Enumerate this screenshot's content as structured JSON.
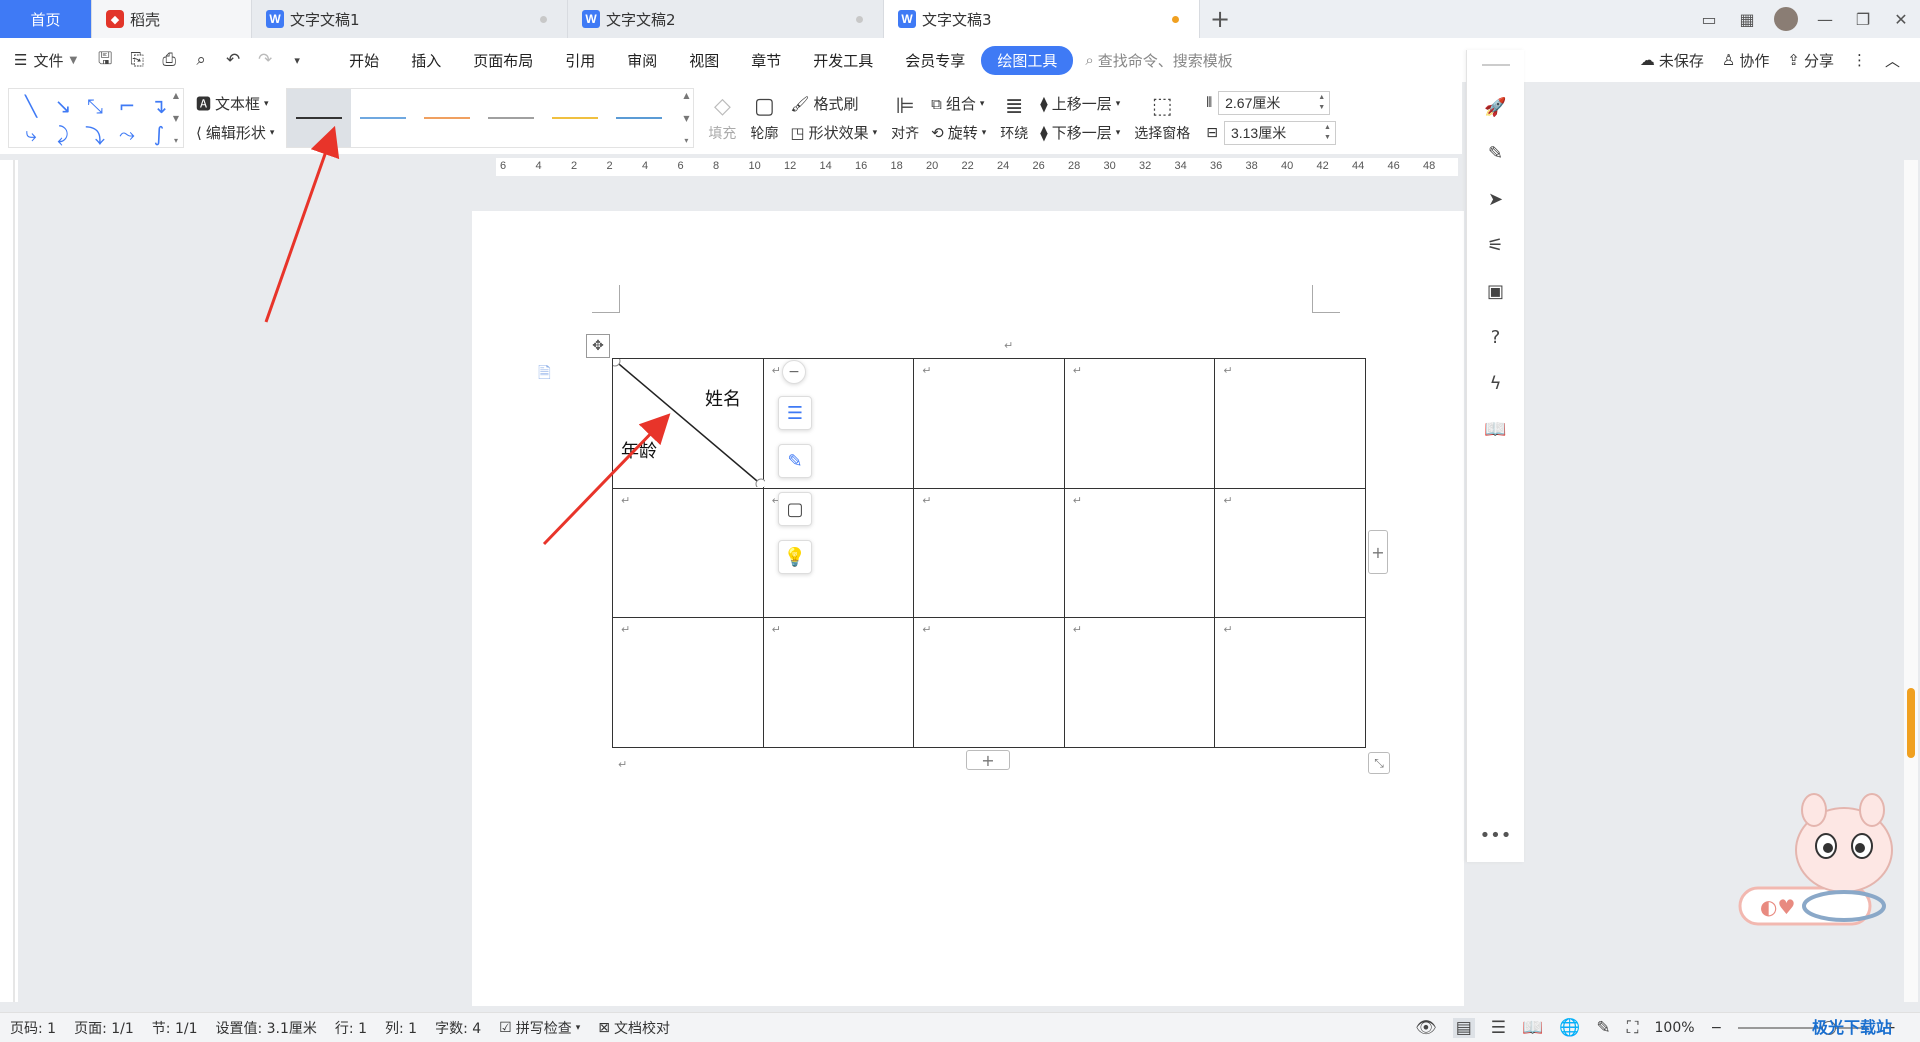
{
  "tabs": {
    "home": "首页",
    "daoke": "稻壳",
    "doc1": "文字文稿1",
    "doc2": "文字文稿2",
    "doc3": "文字文稿3",
    "doc_icon": "W",
    "add": "+"
  },
  "menu": {
    "file": "文件",
    "items": [
      "开始",
      "插入",
      "页面布局",
      "引用",
      "审阅",
      "视图",
      "章节",
      "开发工具",
      "会员专享"
    ],
    "active": "绘图工具",
    "search_placeholder": "查找命令、搜索模板",
    "unsaved": "未保存",
    "collab": "协作",
    "share": "分享"
  },
  "ribbon": {
    "textbox": "文本框",
    "edit_shape": "编辑形状",
    "fill": "填充",
    "outline": "轮廓",
    "format_painter": "格式刷",
    "shape_effect": "形状效果",
    "align": "对齐",
    "group": "组合",
    "rotate": "旋转",
    "wrap": "环绕",
    "bring_forward": "上移一层",
    "send_backward": "下移一层",
    "selection_pane": "选择窗格",
    "height": "2.67厘米",
    "width": "3.13厘米",
    "line_colors": [
      "#333333",
      "#6fa8e0",
      "#f0a060",
      "#a0a0a0",
      "#f0c040",
      "#5b9bd5"
    ]
  },
  "ruler_labels": [
    "6",
    "4",
    "2",
    "2",
    "4",
    "6",
    "8",
    "10",
    "12",
    "14",
    "16",
    "18",
    "20",
    "22",
    "24",
    "26",
    "28",
    "30",
    "32",
    "34",
    "36",
    "38",
    "40",
    "42",
    "44",
    "46",
    "48"
  ],
  "table": {
    "header_top": "姓名",
    "header_bottom": "年龄",
    "para_mark": "↵"
  },
  "status": {
    "page_num": "页码: 1",
    "pages": "页面: 1/1",
    "section": "节: 1/1",
    "setting": "设置值: 3.1厘米",
    "row": "行: 1",
    "col": "列: 1",
    "words": "字数: 4",
    "spellcheck": "拼写检查",
    "proofread": "文档校对",
    "zoom": "100%"
  },
  "watermark": "极光下载站",
  "colors": {
    "accent": "#3f7af5",
    "arrow": "#e8342a"
  }
}
